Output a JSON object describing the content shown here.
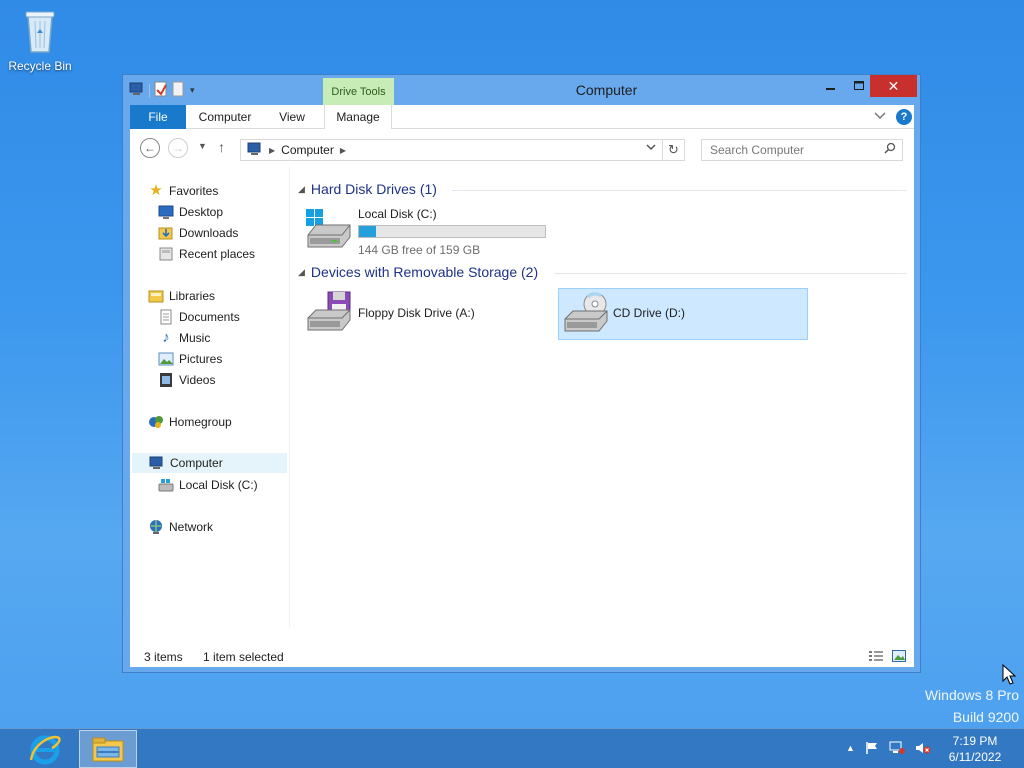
{
  "desktop": {
    "recycle_bin_label": "Recycle Bin",
    "watermark_line1": "Windows 8 Pro",
    "watermark_line2": "Build 9200"
  },
  "window": {
    "title": "Computer",
    "contextual_band": "Drive Tools",
    "tabs": {
      "file": "File",
      "computer": "Computer",
      "view": "View",
      "manage": "Manage"
    },
    "controls": {
      "close": "✕"
    }
  },
  "navbar": {
    "breadcrumb": "Computer",
    "search_placeholder": "Search Computer"
  },
  "navpane": {
    "favorites": "Favorites",
    "desktop": "Desktop",
    "downloads": "Downloads",
    "recent": "Recent places",
    "libraries": "Libraries",
    "documents": "Documents",
    "music": "Music",
    "pictures": "Pictures",
    "videos": "Videos",
    "homegroup": "Homegroup",
    "computer": "Computer",
    "local_disk": "Local Disk (C:)",
    "network": "Network"
  },
  "content": {
    "group_hdd": "Hard Disk Drives (1)",
    "group_removable": "Devices with Removable Storage (2)",
    "local_disk": {
      "name": "Local Disk (C:)",
      "free_text": "144 GB free of 159 GB",
      "used_fraction": 0.094
    },
    "floppy": {
      "name": "Floppy Disk Drive (A:)"
    },
    "cd": {
      "name": "CD Drive (D:)"
    }
  },
  "statusbar": {
    "items": "3 items",
    "selected": "1 item selected"
  },
  "taskbar": {
    "time": "7:19 PM",
    "date": "6/11/2022"
  },
  "colors": {
    "accent": "#1979ca",
    "usage_fill": "#26a0da",
    "close_red": "#c7302c",
    "selection": "#cde8ff"
  }
}
